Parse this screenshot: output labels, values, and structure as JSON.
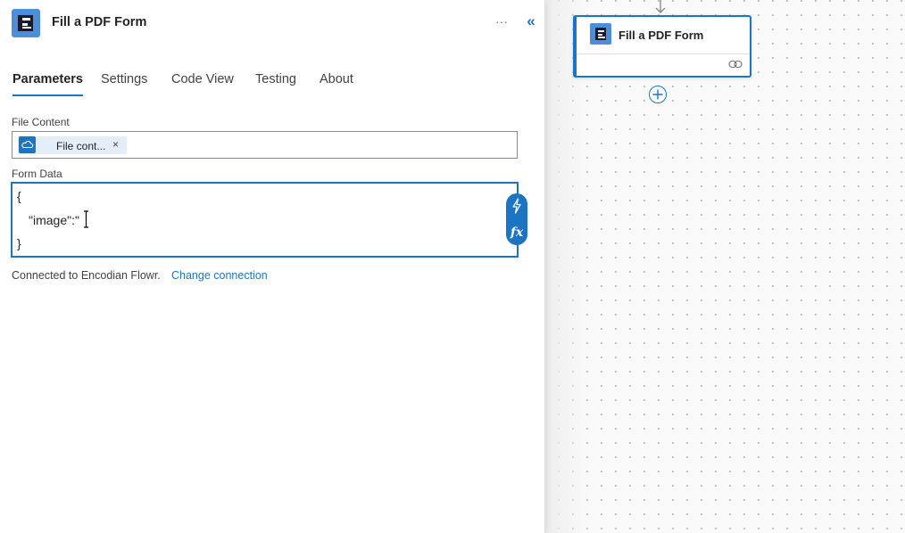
{
  "panel": {
    "title": "Fill a PDF Form",
    "more_icon": "more-horizontal-icon",
    "more_label": "···",
    "collapse_icon": "double-chevron-left-icon",
    "collapse_label": "«",
    "app_icon": "encodian-logo-icon"
  },
  "tabs": [
    {
      "label": "Parameters",
      "active": true
    },
    {
      "label": "Settings",
      "active": false
    },
    {
      "label": "Code View",
      "active": false
    },
    {
      "label": "Testing",
      "active": false
    },
    {
      "label": "About",
      "active": false
    }
  ],
  "file_content": {
    "label": "File Content",
    "token_icon": "cloud-icon",
    "token_label": "File cont...",
    "token_remove": "×"
  },
  "form_data": {
    "label": "Form Data",
    "lines": [
      "{",
      "\"image\":\"",
      "}"
    ],
    "dynamic_icon": "lightning-icon",
    "expression_icon": "fx-icon",
    "expression_label": "fx"
  },
  "connection": {
    "text": "Connected to Encodian Flowr.",
    "link": "Change connection"
  },
  "canvas": {
    "node_title": "Fill a PDF Form",
    "node_icon": "encodian-logo-icon",
    "link_icon": "link-icon",
    "add_icon": "plus-icon",
    "arrow_icon": "arrow-down-icon"
  },
  "colors": {
    "accent": "#1b75c4",
    "app_icon_bg": "#4b8fd9",
    "token_bg": "#e4eef9"
  }
}
